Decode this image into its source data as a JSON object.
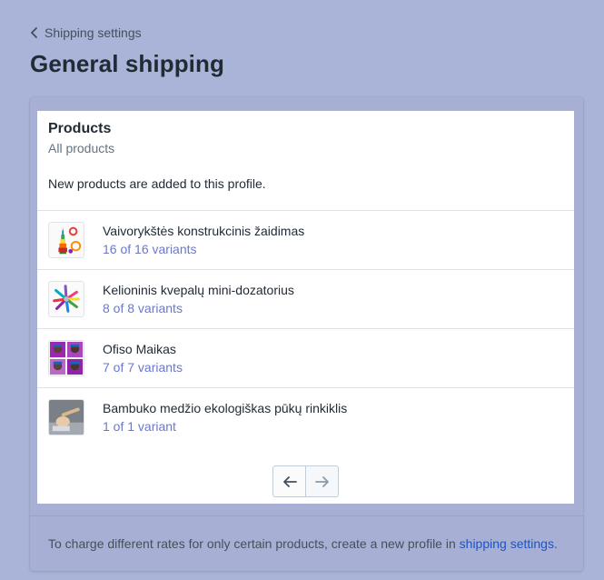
{
  "breadcrumb": {
    "label": "Shipping settings",
    "icon": "chevron-left-icon"
  },
  "page": {
    "title": "General shipping"
  },
  "products_panel": {
    "title": "Products",
    "subtitle": "All products",
    "note": "New products are added to this profile.",
    "items": [
      {
        "name": "Vaivorykštės konstrukcinis žaidimas",
        "variants": "16 of 16 variants",
        "image": "rainbow-stacking-toy-image"
      },
      {
        "name": "Kelioninis kvepalų mini-dozatorius",
        "variants": "8 of 8 variants",
        "image": "perfume-atomizers-image"
      },
      {
        "name": "Ofiso Maikas",
        "variants": "7 of 7 variants",
        "image": "office-tshirt-image"
      },
      {
        "name": "Bambuko medžio ekologiškas pūkų rinkiklis",
        "variants": "1 of 1 variant",
        "image": "bamboo-lint-remover-image"
      }
    ],
    "pagination": {
      "prev_icon": "arrow-left-icon",
      "next_icon": "arrow-right-icon"
    }
  },
  "footer": {
    "text": "To charge different rates for only certain products, create a new profile in ",
    "link": "shipping settings",
    "suffix": "."
  },
  "colors": {
    "background": "#aab3d8",
    "link": "#1f54c0",
    "variant_text": "#5c6ac4",
    "title": "#212b36"
  }
}
